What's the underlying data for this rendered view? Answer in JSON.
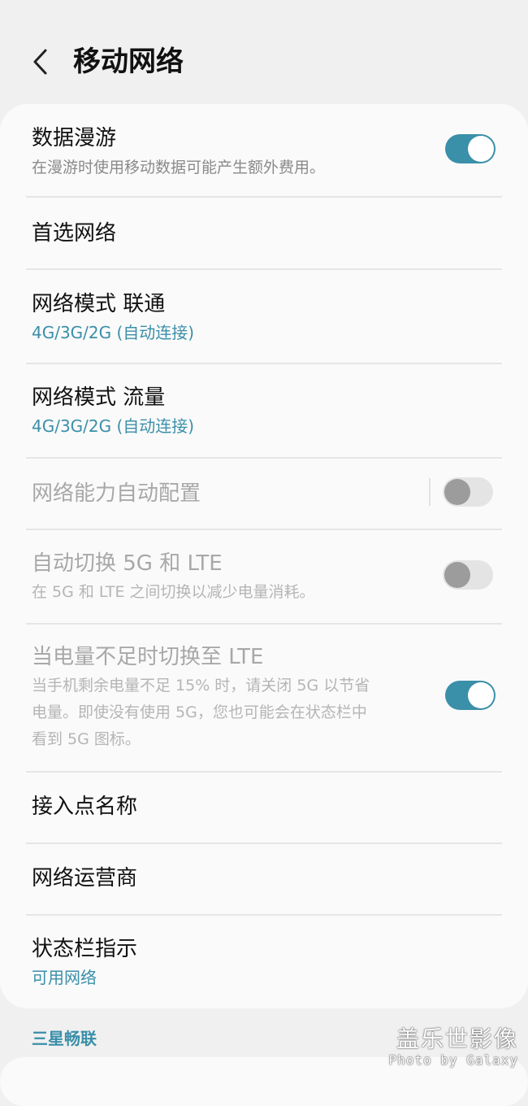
{
  "header": {
    "title": "移动网络",
    "back_icon": "chevron-left-icon"
  },
  "settings": [
    {
      "title": "数据漫游",
      "subtitle": "在漫游时使用移动数据可能产生额外费用。",
      "toggle": "on"
    },
    {
      "title": "首选网络"
    },
    {
      "title": "网络模式 联通",
      "subtitle": "4G/3G/2G (自动连接)"
    },
    {
      "title": "网络模式 流量",
      "subtitle": "4G/3G/2G (自动连接)"
    },
    {
      "title": "网络能力自动配置",
      "toggle": "off",
      "disabled": true
    },
    {
      "title": "自动切换 5G 和 LTE",
      "subtitle": "在 5G 和 LTE 之间切换以减少电量消耗。",
      "toggle": "off",
      "disabled": true
    },
    {
      "title": "当电量不足时切换至 LTE",
      "subtitle_lines": [
        "当手机剩余电量不足 15% 时，请关闭 5G 以节省",
        "电量。即使没有使用 5G，您也可能会在状态栏中",
        "看到 5G 图标。"
      ],
      "toggle": "on",
      "disabled": true
    },
    {
      "title": "接入点名称"
    },
    {
      "title": "网络运营商"
    },
    {
      "title": "状态栏指示",
      "subtitle": "可用网络"
    }
  ],
  "section": {
    "label": "三星畅联"
  },
  "watermark": {
    "main": "盖乐世影像",
    "sub": "Photo by Galaxy"
  },
  "colors": {
    "accent": "#3a8fa9",
    "background": "#f0f0f0",
    "card": "#fafafa",
    "disabled_text": "#a8a8a8"
  }
}
